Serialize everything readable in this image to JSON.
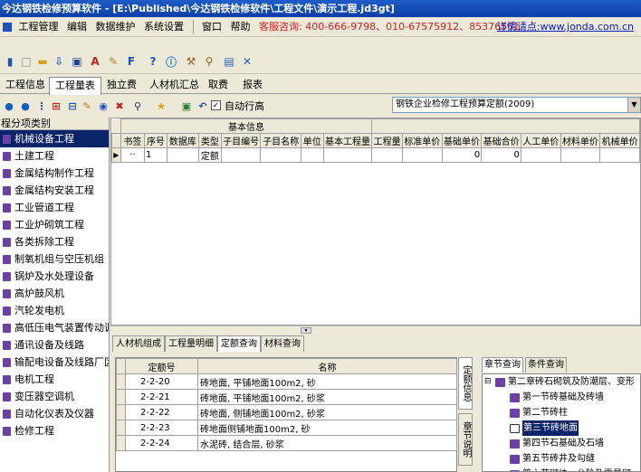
{
  "window": {
    "title": "今达钢铁检修预算软件 - [E:\\Published\\今达钢铁检修软件\\工程文件\\演示工程.jd3gt]"
  },
  "menu": {
    "items": [
      "工程管理",
      "编辑",
      "数据维护",
      "系统设置",
      "窗口",
      "帮助"
    ],
    "hotline": "客服咨询: 400-666-9798、010-67575912、85376561",
    "url": "详情请点:www.jonda.com.cn"
  },
  "toolbar_icons": [
    "toolbar-collapse-icon",
    "new-icon",
    "open-icon",
    "import-icon",
    "save-icon",
    "pdf-icon",
    "edit-icon",
    "f-icon",
    "help-icon",
    "info-icon",
    "tool-icon",
    "search-icon",
    "calculator-icon",
    "close-icon"
  ],
  "tabs": [
    "工程信息",
    "工程量表",
    "独立费",
    "人材机汇总",
    "取费",
    "报表"
  ],
  "active_tab": 1,
  "toolbar2": {
    "auto_row_label": "自动行高",
    "quota_combo": "钢铁企业检修工程预算定额(2009)"
  },
  "left_panel": {
    "title": "程分项类别",
    "items": [
      "机械设备工程",
      "土建工程",
      "金属结构制作工程",
      "金属结构安装工程",
      "工业管道工程",
      "工业炉砌筑工程",
      "各类拆除工程",
      "制氧机组与空压机组",
      "锅炉及水处理设备",
      "高炉鼓风机",
      "汽轮发电机",
      "高低压电气装置传动调试",
      "通讯设备及线路",
      "输配电设备及线路厂区",
      "电机工程",
      "变压器空调机",
      "自动化仪表及仪器",
      "检修工程"
    ]
  },
  "grid": {
    "group_header": "基本信息",
    "columns": [
      "书签",
      "序号",
      "数据库",
      "类型",
      "子目编号",
      "子目名称",
      "单位",
      "基本工程量",
      "工程量",
      "标准单价",
      "基础单价",
      "基础合价",
      "人工单价",
      "材料单价",
      "机械单价"
    ],
    "rows": [
      {
        "seq": "1",
        "type": "定额",
        "base_price": "0",
        "base_total": "0"
      }
    ]
  },
  "bottom_tabs": [
    "人材机组成",
    "工程量明细",
    "定额查询",
    "材料查询"
  ],
  "bottom_active": 2,
  "quota_table": {
    "headers": [
      "定额号",
      "名称"
    ],
    "rows": [
      {
        "code": "2-2-20",
        "name": "砖地面, 平铺地面100m2, 砂"
      },
      {
        "code": "2-2-21",
        "name": "砖地面, 平铺地面100m2, 砂浆"
      },
      {
        "code": "2-2-22",
        "name": "砖地面, 侧铺地面100m2, 砂浆"
      },
      {
        "code": "2-2-23",
        "name": "砖地面侧铺地面100m2, 砂"
      },
      {
        "code": "2-2-24",
        "name": "水泥砖, 结合层, 砂浆"
      }
    ]
  },
  "vertical_tabs": [
    "定额信息",
    "章节说明"
  ],
  "right_panel": {
    "tabs": [
      "章节查询",
      "条件查询"
    ],
    "tree": [
      {
        "label": "第二章砖石砌筑及防潮层、变形",
        "level": 0
      },
      {
        "label": "第一节砖基础及砖墙",
        "level": 1
      },
      {
        "label": "第二节砖柱",
        "level": 1
      },
      {
        "label": "第三节砖地面",
        "level": 1,
        "selected": true
      },
      {
        "label": "第四节石基础及石墙",
        "level": 1
      },
      {
        "label": "第五节砖井及勾缝",
        "level": 1
      },
      {
        "label": "第六节砌块、台阶及零星砌",
        "level": 1
      }
    ]
  }
}
